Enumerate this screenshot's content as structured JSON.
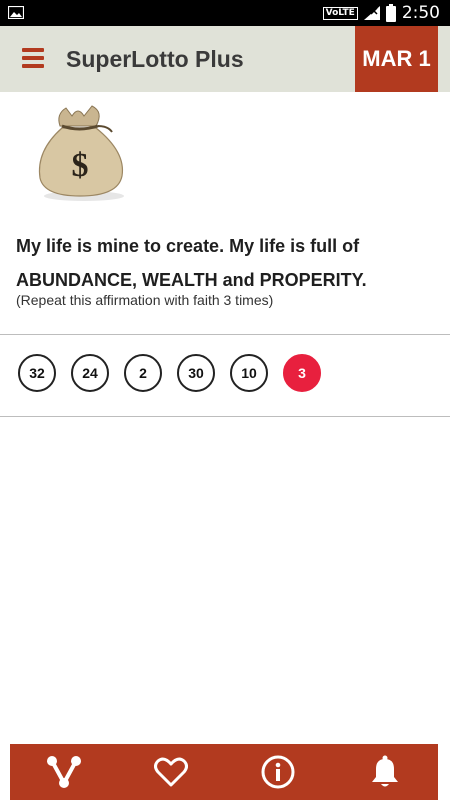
{
  "status_bar": {
    "network_badge": "VoLTE",
    "time": "2:50"
  },
  "app_bar": {
    "title": "SuperLotto Plus",
    "date": "MAR 1"
  },
  "affirmation": {
    "line1": "My life is mine to create. My life is full of",
    "line2": "ABUNDANCE, WEALTH and PROPERITY.",
    "note": "(Repeat this affirmation with faith 3 times)"
  },
  "numbers": [
    "32",
    "24",
    "2",
    "30",
    "10"
  ],
  "mega_number": "3",
  "bottom_nav": {
    "icons": [
      "share-icon",
      "heart-icon",
      "info-icon",
      "bell-icon"
    ]
  },
  "colors": {
    "brand": "#b23a1f",
    "mega": "#e8203e",
    "appbar_bg": "#e0e2d8"
  }
}
